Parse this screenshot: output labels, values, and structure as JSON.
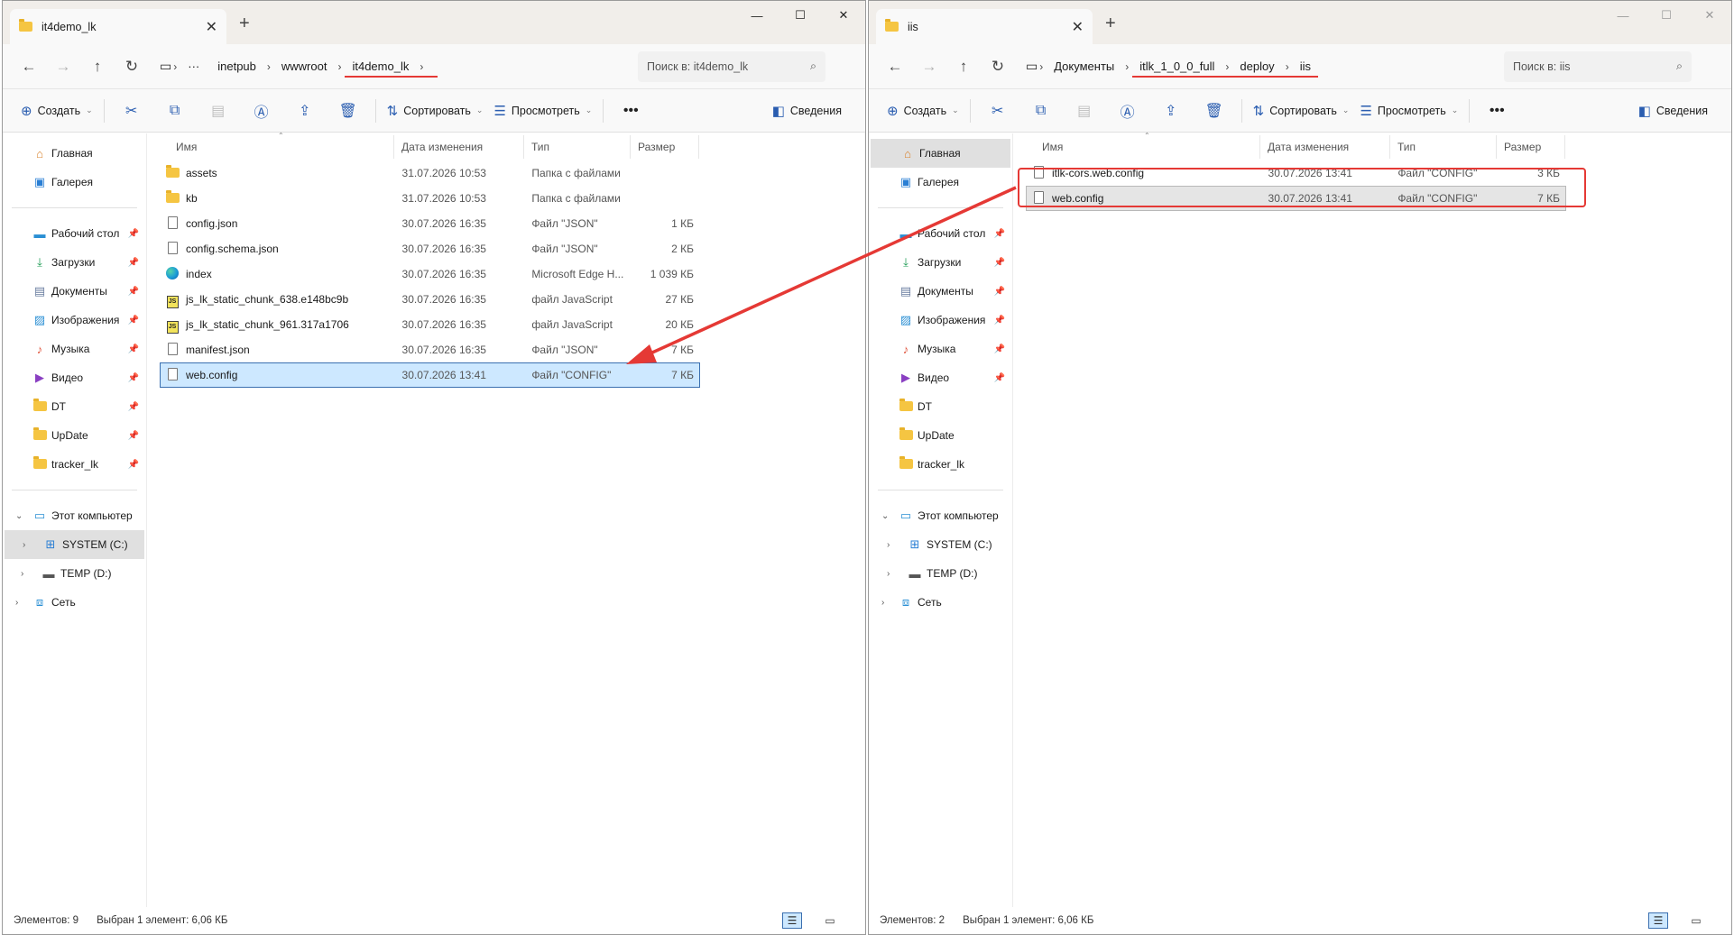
{
  "left": {
    "tab_title": "it4demo_lk",
    "breadcrumb": [
      "inetpub",
      "wwwroot",
      "it4demo_lk"
    ],
    "search_placeholder": "Поиск в: it4demo_lk",
    "toolbar": {
      "create": "Создать",
      "sort": "Сортировать",
      "view": "Просмотреть",
      "details": "Сведения"
    },
    "columns": {
      "name": "Имя",
      "date": "Дата изменения",
      "type": "Тип",
      "size": "Размер"
    },
    "files": [
      {
        "name": "assets",
        "date": "31.07.2026 10:53",
        "type": "Папка с файлами",
        "size": "",
        "icon": "folder"
      },
      {
        "name": "kb",
        "date": "31.07.2026 10:53",
        "type": "Папка с файлами",
        "size": "",
        "icon": "folder"
      },
      {
        "name": "config.json",
        "date": "30.07.2026 16:35",
        "type": "Файл \"JSON\"",
        "size": "1 КБ",
        "icon": "doc"
      },
      {
        "name": "config.schema.json",
        "date": "30.07.2026 16:35",
        "type": "Файл \"JSON\"",
        "size": "2 КБ",
        "icon": "doc"
      },
      {
        "name": "index",
        "date": "30.07.2026 16:35",
        "type": "Microsoft Edge H...",
        "size": "1 039 КБ",
        "icon": "edge"
      },
      {
        "name": "js_lk_static_chunk_638.e148bc9b",
        "date": "30.07.2026 16:35",
        "type": "файл JavaScript",
        "size": "27 КБ",
        "icon": "js"
      },
      {
        "name": "js_lk_static_chunk_961.317a1706",
        "date": "30.07.2026 16:35",
        "type": "файл JavaScript",
        "size": "20 КБ",
        "icon": "js"
      },
      {
        "name": "manifest.json",
        "date": "30.07.2026 16:35",
        "type": "Файл \"JSON\"",
        "size": "7 КБ",
        "icon": "doc"
      },
      {
        "name": "web.config",
        "date": "30.07.2026 13:41",
        "type": "Файл \"CONFIG\"",
        "size": "7 КБ",
        "icon": "doc"
      }
    ],
    "status": {
      "count": "Элементов: 9",
      "selection": "Выбран 1 элемент: 6,06 КБ"
    }
  },
  "right": {
    "tab_title": "iis",
    "breadcrumb": [
      "Документы",
      "itlk_1_0_0_full",
      "deploy",
      "iis"
    ],
    "search_placeholder": "Поиск в: iis",
    "toolbar": {
      "create": "Создать",
      "sort": "Сортировать",
      "view": "Просмотреть",
      "details": "Сведения"
    },
    "columns": {
      "name": "Имя",
      "date": "Дата изменения",
      "type": "Тип",
      "size": "Размер"
    },
    "files": [
      {
        "name": "itlk-cors.web.config",
        "date": "30.07.2026 13:41",
        "type": "Файл \"CONFIG\"",
        "size": "3 КБ",
        "icon": "doc"
      },
      {
        "name": "web.config",
        "date": "30.07.2026 13:41",
        "type": "Файл \"CONFIG\"",
        "size": "7 КБ",
        "icon": "doc"
      }
    ],
    "status": {
      "count": "Элементов: 2",
      "selection": "Выбран 1 элемент: 6,06 КБ"
    }
  },
  "nav": {
    "home": "Главная",
    "gallery": "Галерея",
    "quick": [
      {
        "label": "Рабочий стол",
        "icon": "desktop-icon",
        "pinned": true
      },
      {
        "label": "Загрузки",
        "icon": "download-icon",
        "pinned": true
      },
      {
        "label": "Документы",
        "icon": "documents-icon",
        "pinned": true
      },
      {
        "label": "Изображения",
        "icon": "pictures-icon",
        "pinned": true
      },
      {
        "label": "Музыка",
        "icon": "music-icon",
        "pinned": true
      },
      {
        "label": "Видео",
        "icon": "video-icon",
        "pinned": true
      },
      {
        "label": "DT",
        "icon": "folder-icon",
        "pinned": true
      },
      {
        "label": "UpDate",
        "icon": "folder-icon",
        "pinned": true
      },
      {
        "label": "tracker_lk",
        "icon": "folder-icon",
        "pinned": true
      }
    ],
    "this_pc": "Этот компьютер",
    "drive_c": "SYSTEM (C:)",
    "drive_d": "TEMP (D:)",
    "network": "Сеть"
  },
  "colors": {
    "accent": "#3a6fb0",
    "annotation": "#e53935",
    "selection": "#cde8ff"
  }
}
